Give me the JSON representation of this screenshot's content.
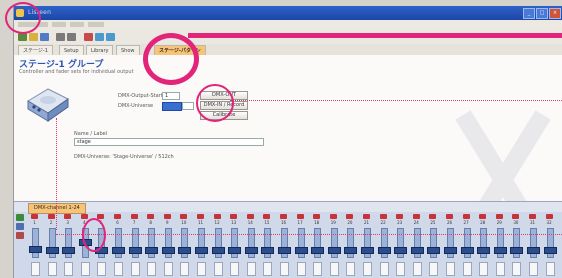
{
  "window": {
    "app_menu_label": "Listeen"
  },
  "tabs": [
    {
      "label": "ステージ-1"
    },
    {
      "label": "Setup"
    },
    {
      "label": "Library"
    },
    {
      "label": "Show"
    },
    {
      "label": "ステージ-パターン"
    }
  ],
  "page": {
    "heading": "ステージ-1 グループ",
    "subheading": "Controller and fader sets for individual output",
    "form": {
      "field1_label": "DMX-Output-Start",
      "field1_value": "1",
      "field2_label": "DMX-Universe",
      "name_label": "Name / Label",
      "name_value": "stage",
      "note": "DMX-Universe: 'Stage-Universe' / 512ch"
    },
    "buttons": [
      {
        "label": "DMX-OUT"
      },
      {
        "label": "DMX-IN / Record"
      },
      {
        "label": "Calibrate"
      }
    ]
  },
  "bottom_panel": {
    "tab_label": "DMX-channel 1-24",
    "channels": [
      "1",
      "2",
      "3",
      "4",
      "5",
      "6",
      "7",
      "8",
      "9",
      "10",
      "11",
      "12",
      "13",
      "14",
      "15",
      "16",
      "17",
      "18",
      "19",
      "20",
      "21",
      "22",
      "23",
      "24",
      "25",
      "26",
      "27",
      "28",
      "29",
      "30",
      "31",
      "32"
    ],
    "levels": [
      0.25,
      0.2,
      0.2,
      0.55,
      0.2,
      0.2,
      0.2,
      0.2,
      0.2,
      0.2,
      0.2,
      0.2,
      0.2,
      0.2,
      0.2,
      0.2,
      0.2,
      0.2,
      0.2,
      0.2,
      0.2,
      0.2,
      0.2,
      0.2,
      0.2,
      0.2,
      0.2,
      0.2,
      0.2,
      0.2,
      0.2,
      0.2
    ],
    "active": [
      true,
      true,
      true,
      true,
      true,
      true,
      true,
      true,
      true,
      true,
      true,
      true,
      true,
      true,
      true,
      true,
      true,
      true,
      true,
      true,
      true,
      true,
      true,
      true,
      true,
      true,
      true,
      true,
      true,
      true,
      true,
      true
    ]
  },
  "colors": {
    "highlight_magenta": "#e2247a",
    "title_blue": "#1c46a8",
    "active_tab_orange": "#f6c37a",
    "fader_blue": "#2c4c8a"
  },
  "icons": [
    "app-icon",
    "minimize-icon",
    "maximize-icon",
    "close-icon",
    "dmx-interface-device-icon"
  ]
}
